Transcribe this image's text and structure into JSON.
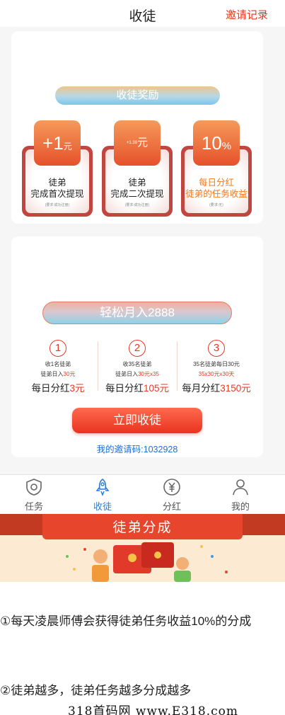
{
  "header": {
    "title": "收徒",
    "records_link": "邀请记录"
  },
  "rewards": {
    "title": "收徒奖励",
    "items": [
      {
        "value": "+1",
        "unit": "元",
        "line1": "徒弟",
        "line2": "完成首次提现",
        "note": "(要求:成功注册)",
        "highlight": false
      },
      {
        "value": "+1.38",
        "unit": "元",
        "line1": "徒弟",
        "line2": "完成二次提现",
        "note": "(要求:成功注册)",
        "highlight": false
      },
      {
        "value": "10",
        "unit": "%",
        "line1": "每日分红",
        "line2": "徒弟的任务收益",
        "note": "(要求:无)",
        "highlight": true
      }
    ]
  },
  "earn": {
    "title": "轻松月入2888",
    "cols": [
      {
        "num": "1",
        "l1": "收1名徒弟",
        "l2a": "徒弟日入",
        "l2b": "30元",
        "l3a": "每日分红",
        "l3b": "3元"
      },
      {
        "num": "2",
        "l1": "收35名徒弟",
        "l2a": "徒弟日入",
        "l2b": "30元x35",
        "l3a": "每日分红",
        "l3b": "105元"
      },
      {
        "num": "3",
        "l1": "35名徒弟每日30元",
        "l2a": "",
        "l2b": "35x30元x30天",
        "l3a": "每月分红",
        "l3b": "3150元"
      }
    ],
    "button": "立即收徒",
    "invite_code": "我的邀请码:1032928"
  },
  "tabbar": [
    {
      "label": "任务",
      "icon": "shield-icon",
      "active": false
    },
    {
      "label": "收徒",
      "icon": "rocket-icon",
      "active": true
    },
    {
      "label": "分红",
      "icon": "yen-icon",
      "active": false
    },
    {
      "label": "我的",
      "icon": "user-icon",
      "active": false
    }
  ],
  "banner": {
    "title": "徒弟分成"
  },
  "article": {
    "p1": "①每天凌晨师傅会获得徒弟任务收益10%的分成",
    "p2": "②徒弟越多，徒弟任务越多分成越多"
  },
  "watermark": "318首码网 www.E318.com",
  "colors": {
    "accent_red": "#e8331f",
    "link_blue": "#1e6fd6",
    "orange": "#f07a1e",
    "tab_active": "#2a7cd8"
  }
}
